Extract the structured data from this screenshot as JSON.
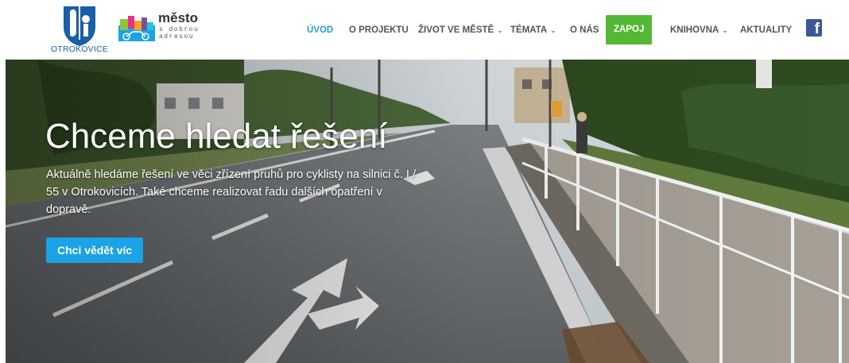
{
  "brand": {
    "city_name": "OTROKOVICE",
    "mesto_title": "město",
    "mesto_line1": "s dobrou",
    "mesto_line2": "adresou"
  },
  "nav": {
    "items": [
      {
        "label": "ÚVOD",
        "active": true,
        "dropdown": false
      },
      {
        "label": "O PROJEKTU",
        "active": false,
        "dropdown": false
      },
      {
        "label": "ŽIVOT VE MĚSTĚ",
        "active": false,
        "dropdown": true
      },
      {
        "label": "TÉMATA",
        "active": false,
        "dropdown": true
      },
      {
        "label": "O NÁS",
        "active": false,
        "dropdown": false
      }
    ],
    "cta": "ZAPOJ SE",
    "items_after": [
      {
        "label": "KNIHOVNA",
        "active": false,
        "dropdown": true
      },
      {
        "label": "AKTUALITY",
        "active": false,
        "dropdown": false
      }
    ],
    "social_icon": "facebook-icon"
  },
  "hero": {
    "title": "Chceme hledat řešení",
    "text": "Aktuálně hledáme řešení ve věci zřízení pruhů pro cyklisty na silnici č. I / 55 v Otrokovicích. Také chceme realizovat řadu dalších opatření v dopravě.",
    "button": "Chci vědět víc"
  },
  "colors": {
    "accent": "#26a0d8",
    "cta_green": "#53b835",
    "hero_button": "#1aa3e6",
    "facebook": "#3b5998"
  }
}
